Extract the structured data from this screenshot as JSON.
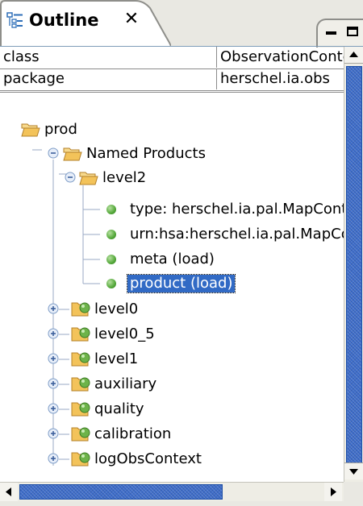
{
  "tab": {
    "title": "Outline",
    "close_glyph": "✕",
    "icon": "outline-icon"
  },
  "window_controls": {
    "minimize_icon": "minimize-icon",
    "maximize_icon": "maximize-icon"
  },
  "properties": {
    "rows": [
      {
        "key": "class",
        "value": "ObservationContext"
      },
      {
        "key": "package",
        "value": "herschel.ia.obs"
      }
    ]
  },
  "tree": {
    "root": {
      "label": "prod",
      "icon": "folder-open-icon"
    },
    "named_products": {
      "label": "Named Products",
      "icon": "folder-open-icon",
      "expanded": true
    },
    "level2": {
      "label": "level2",
      "icon": "folder-open-icon",
      "expanded": true,
      "children": [
        {
          "label": "type: herschel.ia.pal.MapContext"
        },
        {
          "label": "urn:hsa:herschel.ia.pal.MapContext"
        },
        {
          "label": "meta (load)"
        },
        {
          "label": "product (load)",
          "selected": true
        }
      ]
    },
    "contexts": [
      {
        "label": "level0"
      },
      {
        "label": "level0_5"
      },
      {
        "label": "level1"
      },
      {
        "label": "auxiliary"
      },
      {
        "label": "quality"
      },
      {
        "label": "calibration"
      },
      {
        "label": "logObsContext"
      }
    ]
  },
  "colors": {
    "selection": "#316ac5",
    "scroll_thumb": "#3d6cc9",
    "leaf_dot": "#54a83a",
    "folder": "#f3c35a"
  }
}
